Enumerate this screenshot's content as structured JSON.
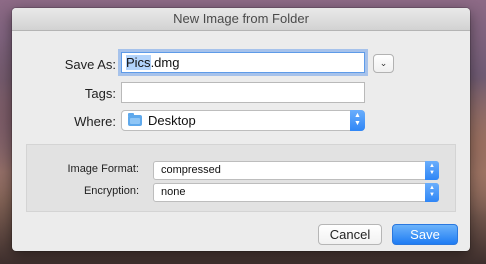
{
  "dialog": {
    "title": "New Image from Folder"
  },
  "form": {
    "save_as_label": "Save As:",
    "save_as_selected": "Pics",
    "save_as_rest": ".dmg",
    "tags_label": "Tags:",
    "tags_value": "",
    "where_label": "Where:",
    "where_value": "Desktop",
    "where_icon": "folder-icon"
  },
  "options": {
    "image_format_label": "Image Format:",
    "image_format_value": "compressed",
    "encryption_label": "Encryption:",
    "encryption_value": "none"
  },
  "buttons": {
    "cancel_label": "Cancel",
    "save_label": "Save"
  },
  "colors": {
    "accent": "#2f86f6",
    "focus_ring": "#5e9be8",
    "selection": "#b3d4fc"
  }
}
